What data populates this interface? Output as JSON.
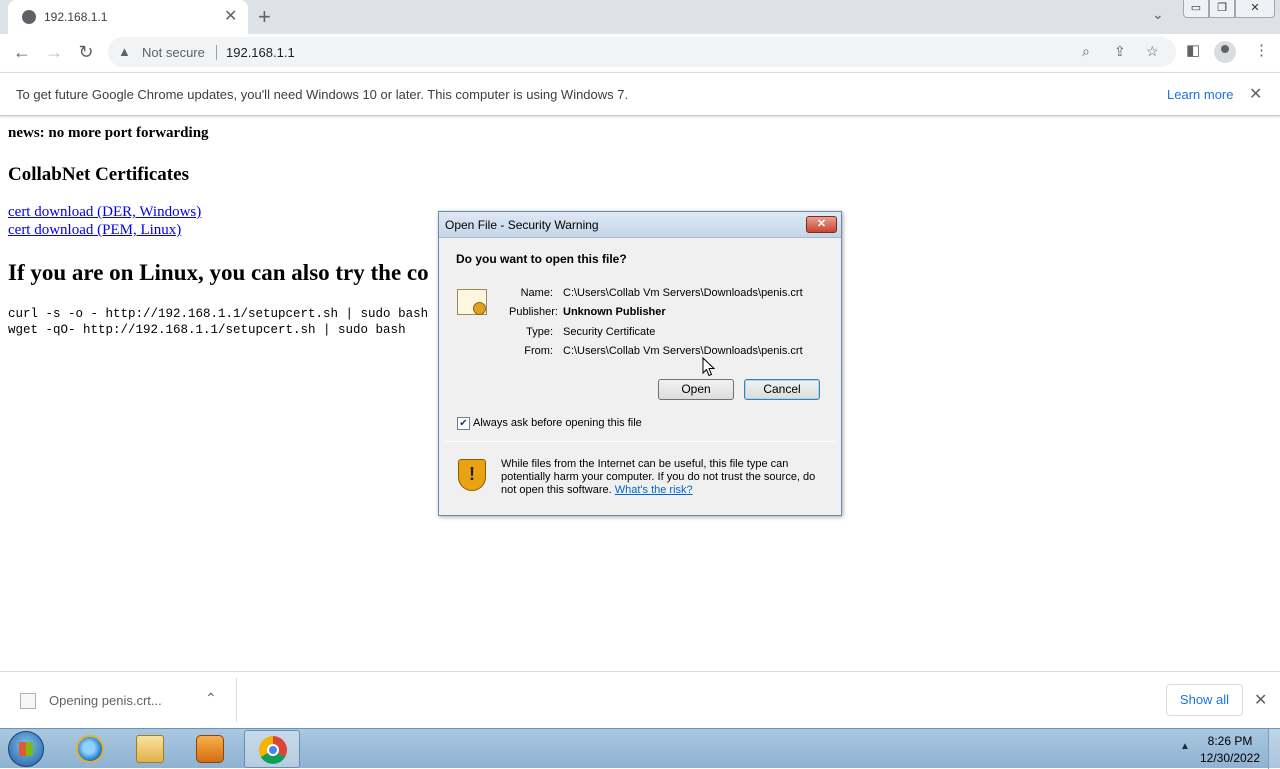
{
  "browser": {
    "tab_title": "192.168.1.1",
    "security_label": "Not secure",
    "url": "192.168.1.1"
  },
  "infobar": {
    "message": "To get future Google Chrome updates, you'll need Windows 10 or later. This computer is using Windows 7.",
    "link": "Learn more"
  },
  "page": {
    "news": "news: no more port forwarding",
    "certs_heading": "CollabNet Certificates",
    "links": [
      "cert download (DER, Windows)",
      "cert download (PEM, Linux)"
    ],
    "linux_heading": "If you are on Linux, you can also try the co",
    "commands": [
      "curl -s -o - http://192.168.1.1/setupcert.sh | sudo bash",
      "wget -qO- http://192.168.1.1/setupcert.sh | sudo bash"
    ]
  },
  "dialog": {
    "title": "Open File - Security Warning",
    "question": "Do you want to open this file?",
    "fields": [
      {
        "label": "Name:",
        "value": "C:\\Users\\Collab Vm Servers\\Downloads\\penis.crt"
      },
      {
        "label": "Publisher:",
        "value": "Unknown Publisher"
      },
      {
        "label": "Type:",
        "value": "Security Certificate"
      },
      {
        "label": "From:",
        "value": "C:\\Users\\Collab Vm Servers\\Downloads\\penis.crt"
      }
    ],
    "open_label": "Open",
    "cancel_label": "Cancel",
    "checkbox_label": "Always ask before opening this file",
    "checkbox_checked": true,
    "warning_text": "While files from the Internet can be useful, this file type can potentially harm your computer. If you do not trust the source, do not open this software.",
    "risk_link": "What's the risk?"
  },
  "downloads": {
    "item_label": "Opening penis.crt...",
    "show_all": "Show all"
  },
  "taskbar": {
    "time": "8:26 PM",
    "date": "12/30/2022"
  },
  "icons": {
    "tab": "globe-icon",
    "tab_close": "close-icon",
    "new_tab": "plus-icon",
    "back": "back-arrow-icon",
    "forward": "forward-arrow-icon",
    "reload": "reload-icon",
    "warning": "warning-triangle-icon",
    "zoom": "search-icon",
    "share": "share-icon",
    "bookmark": "star-icon",
    "sidepanel": "side-panel-icon",
    "profile": "profile-icon",
    "menu": "kebab-menu-icon",
    "dialog_file": "certificate-icon",
    "dialog_shield": "shield-warning-icon",
    "download_file": "file-icon",
    "start": "windows-start-icon",
    "ie": "internet-explorer-icon",
    "explorer": "folder-icon",
    "media": "media-player-icon",
    "chrome": "chrome-icon"
  }
}
